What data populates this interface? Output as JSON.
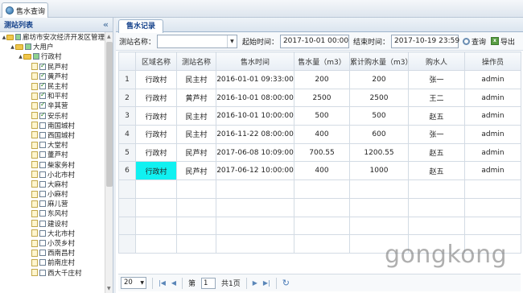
{
  "top_tab": {
    "label": "售水查询"
  },
  "left_panel": {
    "title": "测站列表",
    "collapse": "«"
  },
  "tree": [
    {
      "label": "廊坊市安次经济开发区管理",
      "level": 0,
      "type": "folder",
      "check": "part",
      "toggle": "▲"
    },
    {
      "label": "大用户",
      "level": 1,
      "type": "folder",
      "check": "part",
      "toggle": "▲"
    },
    {
      "label": "行政村",
      "level": 2,
      "type": "folder",
      "check": "part",
      "toggle": "▲"
    },
    {
      "label": "民芦村",
      "level": 3,
      "type": "leaf",
      "check": "on"
    },
    {
      "label": "黄芦村",
      "level": 3,
      "type": "leaf",
      "check": "on"
    },
    {
      "label": "民主村",
      "level": 3,
      "type": "leaf",
      "check": "on"
    },
    {
      "label": "和平村",
      "level": 3,
      "type": "leaf",
      "check": "on"
    },
    {
      "label": "辛其营",
      "level": 3,
      "type": "leaf",
      "check": "on"
    },
    {
      "label": "安乐村",
      "level": 3,
      "type": "leaf",
      "check": "on"
    },
    {
      "label": "南国城村",
      "level": 3,
      "type": "leaf",
      "check": "off"
    },
    {
      "label": "西国城村",
      "level": 3,
      "type": "leaf",
      "check": "off"
    },
    {
      "label": "大堂村",
      "level": 3,
      "type": "leaf",
      "check": "off"
    },
    {
      "label": "董芦村",
      "level": 3,
      "type": "leaf",
      "check": "off"
    },
    {
      "label": "柴家务村",
      "level": 3,
      "type": "leaf",
      "check": "off"
    },
    {
      "label": "小北市村",
      "level": 3,
      "type": "leaf",
      "check": "off"
    },
    {
      "label": "大麻村",
      "level": 3,
      "type": "leaf",
      "check": "off"
    },
    {
      "label": "小麻村",
      "level": 3,
      "type": "leaf",
      "check": "off"
    },
    {
      "label": "麻儿营",
      "level": 3,
      "type": "leaf",
      "check": "off"
    },
    {
      "label": "东风村",
      "level": 3,
      "type": "leaf",
      "check": "off"
    },
    {
      "label": "建设村",
      "level": 3,
      "type": "leaf",
      "check": "off"
    },
    {
      "label": "大北市村",
      "level": 3,
      "type": "leaf",
      "check": "off"
    },
    {
      "label": "小茨乡村",
      "level": 3,
      "type": "leaf",
      "check": "off"
    },
    {
      "label": "西南昌村",
      "level": 3,
      "type": "leaf",
      "check": "off"
    },
    {
      "label": "前南庄村",
      "level": 3,
      "type": "leaf",
      "check": "off"
    },
    {
      "label": "西大千庄村",
      "level": 3,
      "type": "leaf",
      "check": "off"
    }
  ],
  "main_tab": {
    "label": "售水记录"
  },
  "search": {
    "station_label": "测站名称：",
    "station_value": "",
    "start_label": "起始时间：",
    "start_value": "2017-10-01 00:00",
    "end_label": "结束时间：",
    "end_value": "2017-10-19 23:59",
    "query_label": "查询",
    "export_label": "导出"
  },
  "table": {
    "headers": [
      "",
      "区域名称",
      "测站名称",
      "售水时间",
      "售水量（m3）",
      "累计购水量（m3）",
      "购水人",
      "操作员"
    ],
    "rows": [
      [
        "1",
        "行政村",
        "民主村",
        "2016-01-01 09:33:00",
        "200",
        "200",
        "张一",
        "admin"
      ],
      [
        "2",
        "行政村",
        "黄芦村",
        "2016-10-01 08:00:00",
        "2500",
        "2500",
        "王二",
        "admin"
      ],
      [
        "3",
        "行政村",
        "民主村",
        "2016-10-01 10:00:00",
        "500",
        "500",
        "赵五",
        "admin"
      ],
      [
        "4",
        "行政村",
        "民主村",
        "2016-11-22 08:00:00",
        "400",
        "600",
        "张一",
        "admin"
      ],
      [
        "5",
        "行政村",
        "民芦村",
        "2017-06-08 10:09:00",
        "700.55",
        "1200.55",
        "赵五",
        "admin"
      ],
      [
        "6",
        "行政村",
        "民芦村",
        "2017-06-12 10:00:00",
        "400",
        "1000",
        "赵五",
        "admin"
      ]
    ],
    "empty_rows": 4,
    "highlight_color": "#10f1f1"
  },
  "pager": {
    "page_size": "20",
    "first": "|◀",
    "prev": "◀",
    "page_prefix": "第",
    "page_value": "1",
    "page_suffix": "共1页",
    "next": "▶",
    "last": "▶|",
    "refresh": "↻"
  },
  "watermark": "gongkong"
}
